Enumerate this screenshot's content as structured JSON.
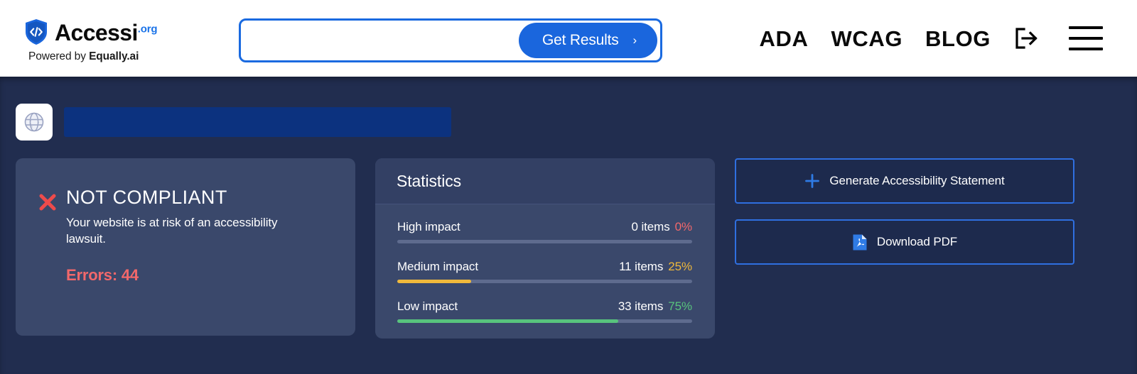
{
  "header": {
    "brand": {
      "name": "Accessi",
      "tld": ".org",
      "tagline_prefix": "Powered by ",
      "tagline_brand": "Equally.ai",
      "shield_icon": "shield-code-icon"
    },
    "search": {
      "value": "",
      "placeholder": "",
      "button_label": "Get Results",
      "button_chevron": "›"
    },
    "nav": [
      {
        "label": "ADA"
      },
      {
        "label": "WCAG"
      },
      {
        "label": "BLOG"
      }
    ],
    "login_icon": "login-arrow-icon",
    "menu_icon": "hamburger-menu-icon"
  },
  "scan": {
    "favicon_icon": "globe-icon",
    "url_value": ""
  },
  "compliance": {
    "status_icon": "red-x-icon",
    "status": "NOT COMPLIANT",
    "description": "Your website is at risk of an accessibility lawsuit.",
    "errors_label": "Errors: 44",
    "status_color": "#ffffff",
    "errors_color": "#f2686b"
  },
  "statistics": {
    "title": "Statistics",
    "rows": [
      {
        "label": "High impact",
        "items": "0 items",
        "percent_label": "0%",
        "percent_value": 0,
        "color": "#f2686b"
      },
      {
        "label": "Medium impact",
        "items": "11 items",
        "percent_label": "25%",
        "percent_value": 25,
        "color": "#f0b93b"
      },
      {
        "label": "Low impact",
        "items": "33 items",
        "percent_label": "75%",
        "percent_value": 75,
        "color": "#58c47d"
      }
    ]
  },
  "actions": [
    {
      "label": "Generate Accessibility Statement",
      "icon": "plus-icon"
    },
    {
      "label": "Download PDF",
      "icon": "pdf-file-icon"
    }
  ],
  "chart_data": {
    "type": "bar",
    "title": "Statistics",
    "categories": [
      "High impact",
      "Medium impact",
      "Low impact"
    ],
    "values": [
      0,
      25,
      75
    ],
    "counts": [
      0,
      11,
      33
    ],
    "value_labels": [
      "0%",
      "25%",
      "75%"
    ],
    "count_labels": [
      "0 items",
      "11 items",
      "33 items"
    ],
    "colors": [
      "#f2686b",
      "#f0b93b",
      "#58c47d"
    ],
    "xlabel": "",
    "ylabel": "",
    "ylim": [
      0,
      100
    ],
    "grid": false,
    "legend": false,
    "total_errors": 44
  }
}
